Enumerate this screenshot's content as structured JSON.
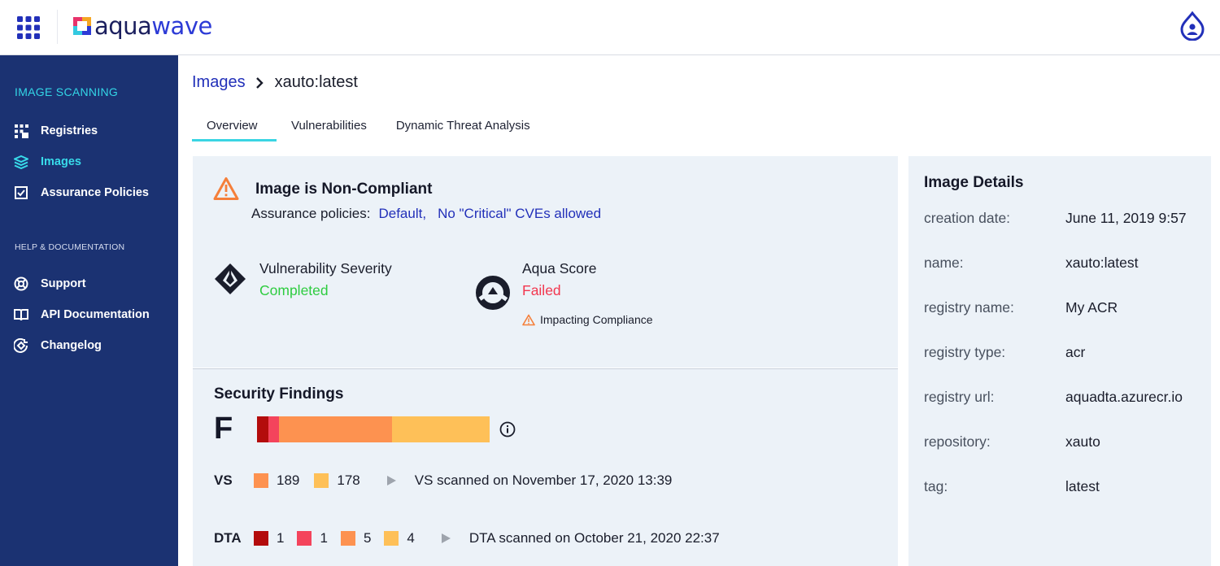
{
  "brand": {
    "logo_part1": "aqua",
    "logo_part2": "wave"
  },
  "sidebar": {
    "section_title": "IMAGE SCANNING",
    "items": [
      {
        "label": "Registries",
        "icon": "registries-icon",
        "active": false
      },
      {
        "label": "Images",
        "icon": "layers-icon",
        "active": true
      },
      {
        "label": "Assurance Policies",
        "icon": "checkbox-icon",
        "active": false
      }
    ],
    "help_title": "HELP & DOCUMENTATION",
    "help_items": [
      {
        "label": "Support",
        "icon": "support-icon"
      },
      {
        "label": "API Documentation",
        "icon": "book-icon"
      },
      {
        "label": "Changelog",
        "icon": "changelog-icon"
      }
    ]
  },
  "breadcrumb": {
    "parent": "Images",
    "current": "xauto:latest"
  },
  "tabs": [
    {
      "label": "Overview",
      "active": true
    },
    {
      "label": "Vulnerabilities",
      "active": false
    },
    {
      "label": "Dynamic Threat Analysis",
      "active": false
    }
  ],
  "compliance": {
    "title": "Image is Non-Compliant",
    "policies_label": "Assurance policies:",
    "policies": [
      "Default,",
      "No \"Critical\" CVEs allowed"
    ]
  },
  "metrics": {
    "vulnerability": {
      "title": "Vulnerability Severity",
      "status": "Completed",
      "status_color": "#2ecc40"
    },
    "aqua_score": {
      "title": "Aqua Score",
      "status": "Failed",
      "status_color": "#f2374f",
      "note": "Impacting Compliance"
    }
  },
  "findings": {
    "title": "Security Findings",
    "grade": "F",
    "bar_segments": [
      {
        "color": "#b30c0c",
        "fraction": 0.05
      },
      {
        "color": "#f4445c",
        "fraction": 0.045
      },
      {
        "color": "#fd9250",
        "fraction": 0.485
      },
      {
        "color": "#fec058",
        "fraction": 0.42
      }
    ],
    "vs": {
      "label": "VS",
      "counts": [
        {
          "color": "#fd9250",
          "value": "189"
        },
        {
          "color": "#fec058",
          "value": "178"
        }
      ],
      "scanned": "VS scanned on November 17, 2020 13:39"
    },
    "dta": {
      "label": "DTA",
      "counts": [
        {
          "color": "#b30c0c",
          "value": "1"
        },
        {
          "color": "#f4445c",
          "value": "1"
        },
        {
          "color": "#fd9250",
          "value": "5"
        },
        {
          "color": "#fec058",
          "value": "4"
        }
      ],
      "scanned": "DTA scanned on October 21, 2020 22:37"
    }
  },
  "image_details": {
    "title": "Image Details",
    "rows": [
      {
        "label": "creation date:",
        "value": "June 11, 2019 9:57"
      },
      {
        "label": "name:",
        "value": "xauto:latest"
      },
      {
        "label": "registry name:",
        "value": "My ACR"
      },
      {
        "label": "registry type:",
        "value": "acr"
      },
      {
        "label": "registry url:",
        "value": "aquadta.azurecr.io"
      },
      {
        "label": "repository:",
        "value": "xauto"
      },
      {
        "label": "tag:",
        "value": "latest"
      }
    ]
  },
  "colors": {
    "accent": "#3ad5e3",
    "sidebar_bg": "#1b3272",
    "link": "#2230b9"
  }
}
